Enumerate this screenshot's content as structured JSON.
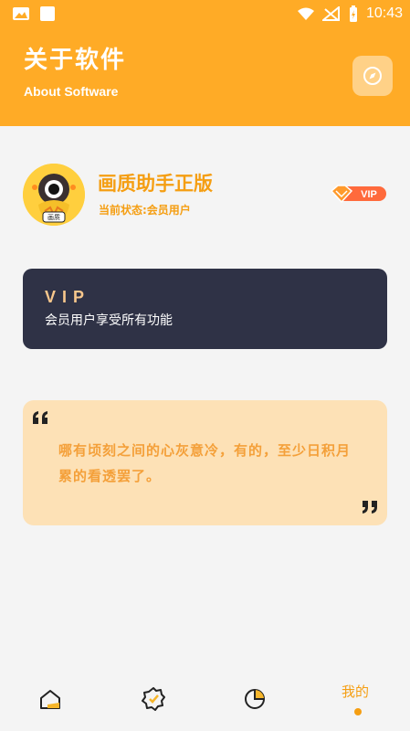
{
  "status_bar": {
    "time": "10:43",
    "icons": [
      "image-icon",
      "square-icon",
      "wifi-icon",
      "signal-off-icon",
      "battery-charging-icon"
    ]
  },
  "header": {
    "title_cn": "关于软件",
    "title_en": "About Software",
    "action_icon": "compass-icon"
  },
  "profile": {
    "app_name": "画质助手正版",
    "status_text": "当前状态:会员用户",
    "badge": "VIP",
    "avatar_label": "画质"
  },
  "vip_card": {
    "title": "VIP",
    "description": "会员用户享受所有功能"
  },
  "quote": {
    "text": "哪有顷刻之间的心灰意冷，有的，至少日积月累的看透罢了。"
  },
  "bottom_nav": {
    "items": [
      {
        "icon": "home-icon",
        "label": "",
        "active": false
      },
      {
        "icon": "badge-check-icon",
        "label": "",
        "active": false
      },
      {
        "icon": "pie-chart-icon",
        "label": "",
        "active": false
      },
      {
        "icon": "",
        "label": "我的",
        "active": true
      }
    ]
  },
  "colors": {
    "header": "#ffab26",
    "accent": "#f59e12",
    "dark_card": "#2f3246",
    "quote_bg": "#fde1b6"
  }
}
